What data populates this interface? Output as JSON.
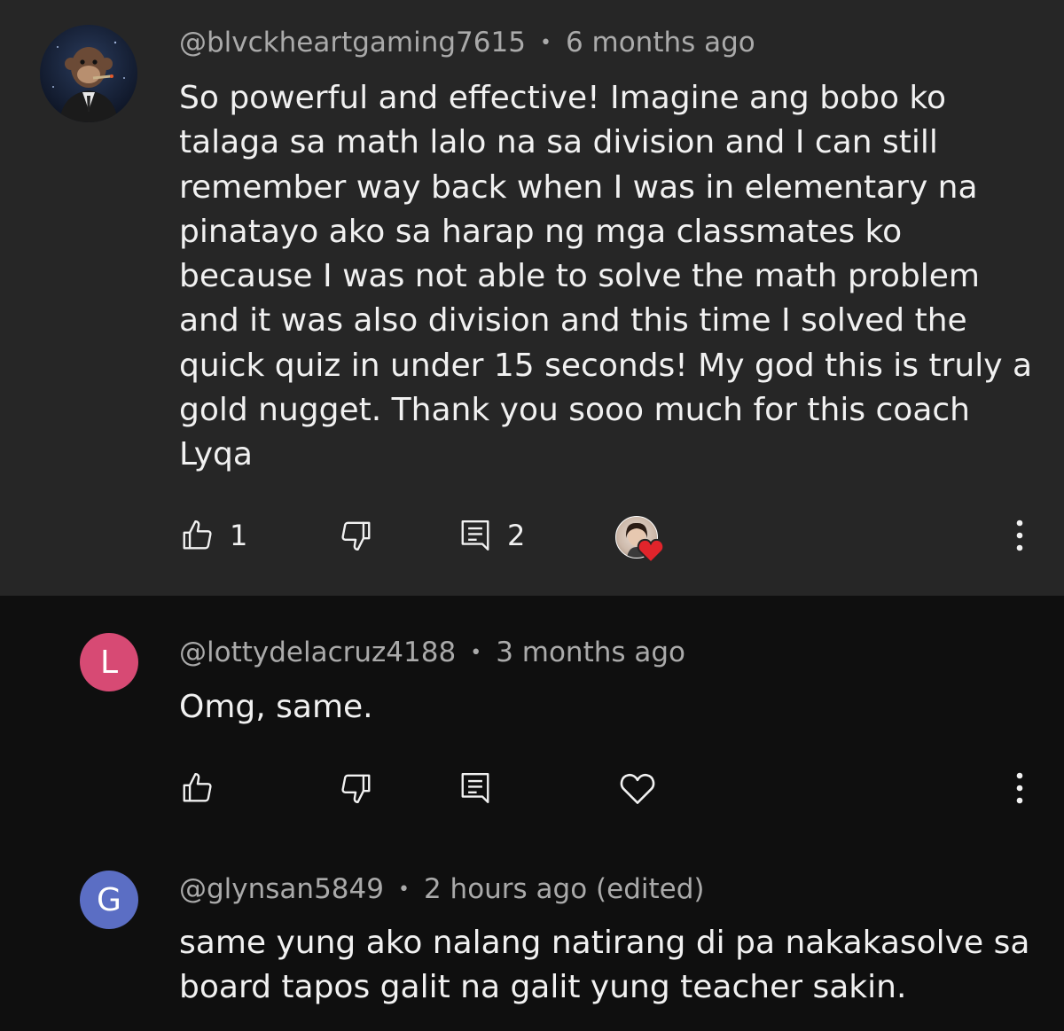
{
  "comments": [
    {
      "author": "@blvckheartgaming7615",
      "time": "6 months ago",
      "lines": [
        "So powerful and effective! Imagine ang bobo ko",
        "talaga sa math lalo na sa division and I can still",
        "remember way back when I was in elementary na",
        "pinatayo ako sa harap ng mga classmates ko",
        "because I was not able to solve the math problem",
        "and it was also division and this time I solved the",
        "quick quiz in under 15 seconds! My god this is truly a",
        "gold nugget. Thank you sooo much for this coach",
        "Lyqa"
      ],
      "like_count": "1",
      "reply_count": "2",
      "avatar_icon": "monkey-avatar-icon",
      "creator_heart": true
    },
    {
      "author": "@lottydelacruz4188",
      "time": "3 months ago",
      "text": "Omg, same.",
      "avatar_letter": "L",
      "avatar_color": "#d74a74"
    },
    {
      "author": "@glynsan5849",
      "time": "2 hours ago (edited)",
      "lines": [
        "same yung ako nalang natirang di pa nakakasolve sa",
        "board tapos galit na galit yung teacher sakin."
      ],
      "avatar_letter": "G",
      "avatar_color": "#5b6ec4"
    }
  ],
  "colors": {
    "background": "#0f0f0f",
    "highlight_background": "#262626",
    "meta_text": "#aaaaaa",
    "heart": "#e0242b"
  }
}
